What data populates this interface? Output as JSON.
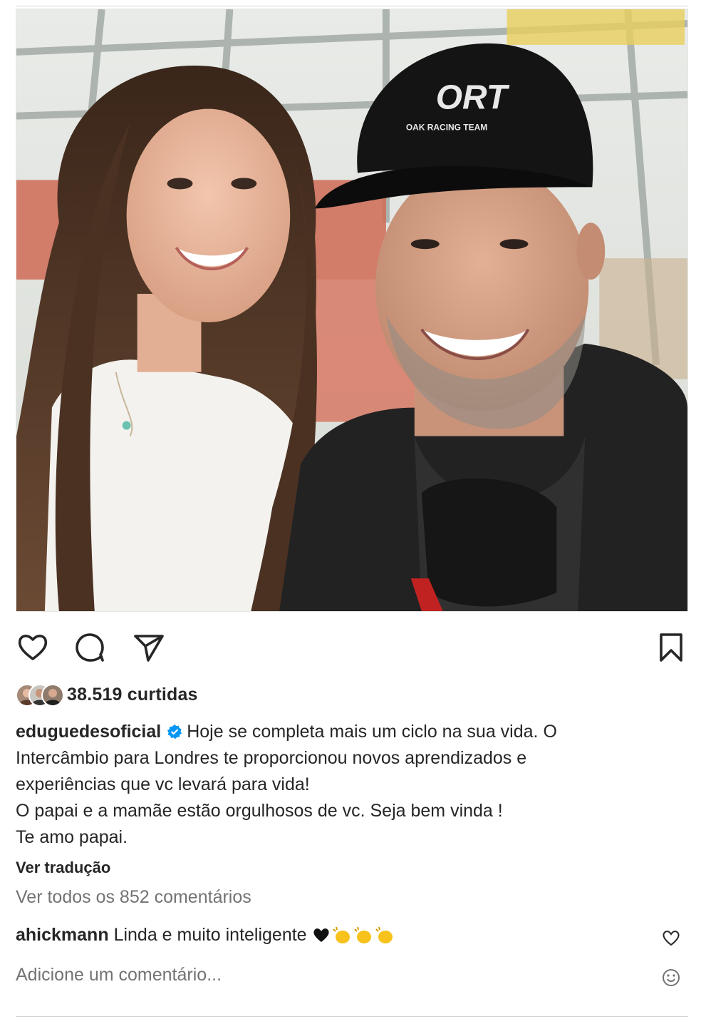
{
  "post": {
    "likes_text": "38.519 curtidas",
    "username": "eduguedesoficial",
    "caption_lines": [
      "Hoje se completa mais um ciclo na sua vida. O",
      "Intercâmbio para Londres te proporcionou novos aprendizados e",
      "experiências que vc levará para vida!",
      "O papai e a mamãe estão orgulhosos de vc. Seja bem vinda !",
      "Te amo papai."
    ],
    "translate_label": "Ver tradução",
    "view_all_comments": "Ver todos os 852 comentários",
    "comment": {
      "username": "ahickmann",
      "text": "Linda e muito inteligente"
    },
    "add_comment_placeholder": "Adicione um comentário...",
    "cap_logo_text": "ORT",
    "cap_logo_subtitle": "OAK RACING TEAM"
  },
  "icons": {
    "like": "heart-outline-icon",
    "comment": "speech-bubble-icon",
    "share": "paper-plane-icon",
    "save": "bookmark-icon",
    "verified": "verified-badge-icon",
    "emoji": "smiley-icon"
  },
  "colors": {
    "text": "#262626",
    "muted": "#737373",
    "verified": "#0095f6",
    "divider": "#d4d4d4"
  }
}
